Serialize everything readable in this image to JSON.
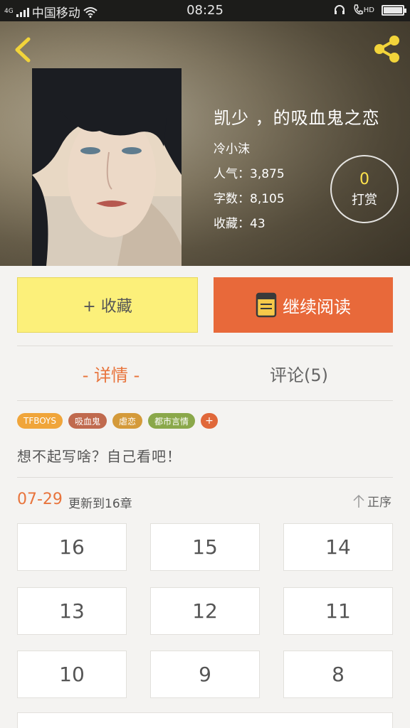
{
  "status_bar": {
    "network": "4G",
    "carrier": "中国移动",
    "time": "08:25",
    "hd": "HD"
  },
  "book": {
    "title": "凯少 ，的吸血鬼之恋",
    "author": "冷小沫",
    "popularity_label": "人气：3,875",
    "word_count_label": "字数：8,105",
    "collected_label": "收藏：43"
  },
  "tip": {
    "count": "0",
    "label": "打赏"
  },
  "actions": {
    "collect_label": "+ 收藏",
    "read_label": "继续阅读"
  },
  "tabs": {
    "detail": "- 详情 -",
    "comments": "评论(5)"
  },
  "tags": [
    {
      "label": "TFBOYS",
      "color": "#f0a53a"
    },
    {
      "label": "吸血鬼",
      "color": "#c06a4e"
    },
    {
      "label": "虐恋",
      "color": "#d49a3a"
    },
    {
      "label": "都市言情",
      "color": "#8aa84a"
    }
  ],
  "tag_more": "+",
  "summary": "想不起写啥？自己看吧！",
  "update": {
    "date": "07-29",
    "text": "更新到16章",
    "sort_label": "正序"
  },
  "chapters": [
    "16",
    "15",
    "14",
    "13",
    "12",
    "11",
    "10",
    "9",
    "8"
  ],
  "colors": {
    "accent": "#e8743c",
    "collect_bg": "#fcf07a",
    "read_bg": "#e8693a",
    "tip_count": "#ffe34d"
  }
}
